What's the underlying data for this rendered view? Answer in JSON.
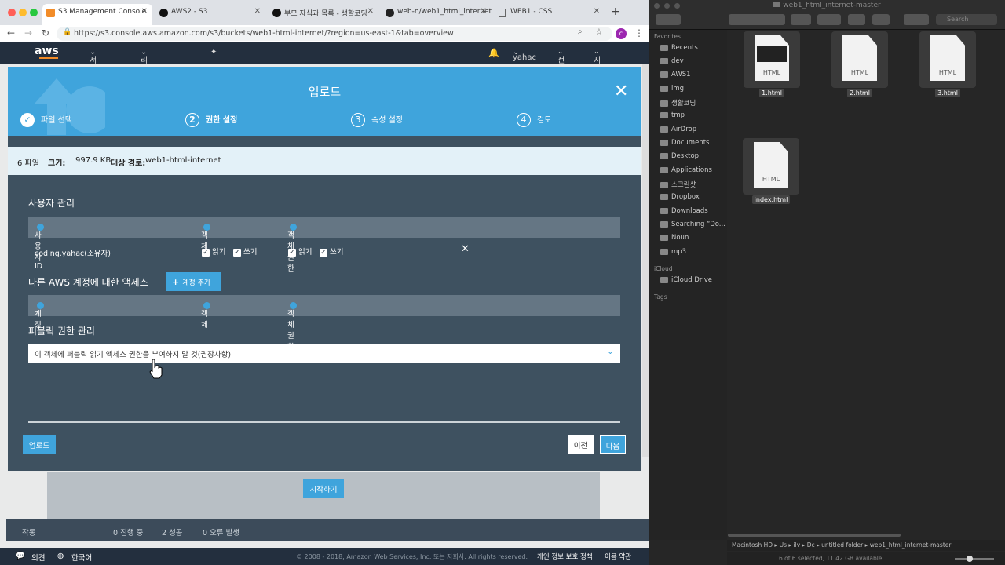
{
  "browser": {
    "tabs": [
      {
        "label": "S3 Management Console",
        "active": true
      },
      {
        "label": "AWS2 - S3"
      },
      {
        "label": "부모 자식과 목록 - 생활코딩"
      },
      {
        "label": "web-n/web1_html_internet"
      },
      {
        "label": "WEB1 - CSS"
      }
    ],
    "url": "https://s3.console.aws.amazon.com/s3/buckets/web1-html-internet/?region=us-east-1&tab=overview",
    "profile_initial": "c"
  },
  "awsnav": {
    "logo": "aws",
    "services": "서비스",
    "resource_groups": "리소스 그룹",
    "user": "yahac",
    "region": "전역",
    "support": "지원"
  },
  "modal": {
    "title": "업로드",
    "steps": [
      {
        "num": "1",
        "label": "파일 선택",
        "done": true
      },
      {
        "num": "2",
        "label": "권한 설정",
        "current": true
      },
      {
        "num": "3",
        "label": "속성 설정"
      },
      {
        "num": "4",
        "label": "검토"
      }
    ],
    "info": {
      "files": "6 파일",
      "size_label": "크기:",
      "size": "997.9 KB",
      "target_label": "대상 경로:",
      "target": "web1-html-internet"
    },
    "user_mgmt": {
      "title": "사용자 관리",
      "headers": [
        "사용자 ID",
        "객체",
        "객체 권한"
      ],
      "row": {
        "user": "coding.yahac(소유자)",
        "read": "읽기",
        "write": "쓰기",
        "read2": "읽기",
        "write2": "쓰기"
      }
    },
    "other_accounts": {
      "title": "다른 AWS 계정에 대한 액세스",
      "add_button": "계정 추가",
      "headers": [
        "계정",
        "객체",
        "객체 권한"
      ]
    },
    "public": {
      "title": "퍼블릭 권한 관리",
      "selected": "이 객체에 퍼블릭 읽기 액세스 권한을 부여하지 말 것(권장사항)"
    },
    "buttons": {
      "upload": "업로드",
      "prev": "이전",
      "next": "다음"
    }
  },
  "page": {
    "start_button": "시작하기"
  },
  "status_footer": {
    "label": "작동",
    "in_progress": "0 진행 중",
    "success": "2 성공",
    "errors": "0 오류 발생"
  },
  "bottombar": {
    "feedback": "의견",
    "language": "한국어",
    "copyright": "© 2008 - 2018, Amazon Web Services, Inc. 또는 자회사. All rights reserved.",
    "privacy": "개인 정보 보호 정책",
    "terms": "이용 약관"
  },
  "finder": {
    "title": "web1_html_internet-master",
    "search_placeholder": "Search",
    "favorites_label": "Favorites",
    "favorites": [
      "Recents",
      "dev",
      "AWS1",
      "img",
      "생활코딩",
      "tmp",
      "AirDrop",
      "Documents",
      "Desktop",
      "Applications",
      "스크린샷",
      "Dropbox",
      "Downloads",
      "Searching “Do...",
      "Noun",
      "mp3"
    ],
    "icloud_label": "iCloud",
    "icloud": [
      "iCloud Drive"
    ],
    "tags_label": "Tags",
    "files": [
      {
        "name": "1.html",
        "type": "HTML"
      },
      {
        "name": "2.html",
        "type": "HTML"
      },
      {
        "name": "3.html",
        "type": "HTML"
      },
      {
        "name": "index.html",
        "type": "HTML"
      }
    ],
    "path": [
      "Macintosh HD",
      "Us",
      "ilv",
      "Dc",
      "untitled folder",
      "web1_html_internet-master"
    ],
    "status": "6 of 6 selected, 11.42 GB available"
  },
  "colors": {
    "aws_blue": "#3fa4dc",
    "aws_dark": "#232f3e",
    "modal_bg": "#3e5160",
    "orange": "#f28c28"
  }
}
